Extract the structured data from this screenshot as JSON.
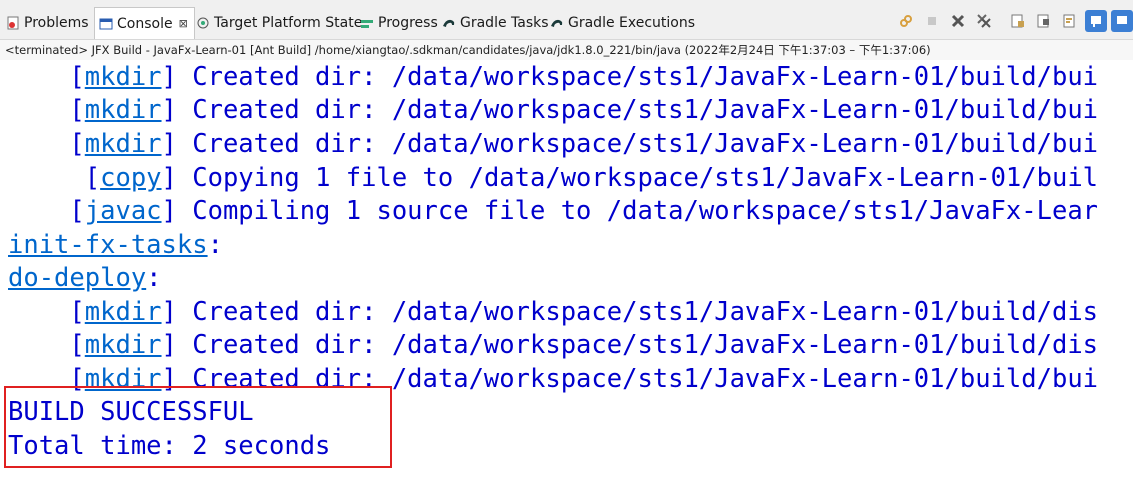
{
  "tabs": [
    {
      "label": "Problems",
      "icon": "problems-icon"
    },
    {
      "label": "Console",
      "icon": "console-icon",
      "close": "⊠"
    },
    {
      "label": "Target Platform State",
      "icon": "target-platform-icon"
    },
    {
      "label": "Progress",
      "icon": "progress-icon"
    },
    {
      "label": "Gradle Tasks",
      "icon": "gradle-icon"
    },
    {
      "label": "Gradle Executions",
      "icon": "gradle-icon"
    }
  ],
  "status": "<terminated> JFX Build - JavaFx-Learn-01 [Ant Build] /home/xiangtao/.sdkman/candidates/java/jdk1.8.0_221/bin/java  (2022年2月24日 下午1:37:03 – 下午1:37:06)",
  "console": {
    "lines": [
      {
        "pre": "    [",
        "tag": "mkdir",
        "post": "] Created dir: /data/workspace/sts1/JavaFx-Learn-01/build/bui"
      },
      {
        "pre": "    [",
        "tag": "mkdir",
        "post": "] Created dir: /data/workspace/sts1/JavaFx-Learn-01/build/bui"
      },
      {
        "pre": "    [",
        "tag": "mkdir",
        "post": "] Created dir: /data/workspace/sts1/JavaFx-Learn-01/build/bui"
      },
      {
        "pre": "     [",
        "tag": "copy",
        "post": "] Copying 1 file to /data/workspace/sts1/JavaFx-Learn-01/buil"
      },
      {
        "pre": "    [",
        "tag": "javac",
        "post": "] Compiling 1 source file to /data/workspace/sts1/JavaFx-Lear"
      },
      {
        "target": "init-fx-tasks",
        "post": ":"
      },
      {
        "target": "do-deploy",
        "post": ":"
      },
      {
        "pre": "    [",
        "tag": "mkdir",
        "post": "] Created dir: /data/workspace/sts1/JavaFx-Learn-01/build/dis"
      },
      {
        "pre": "    [",
        "tag": "mkdir",
        "post": "] Created dir: /data/workspace/sts1/JavaFx-Learn-01/build/dis"
      },
      {
        "pre": "    [",
        "tag": "mkdir",
        "post": "] Created dir: /data/workspace/sts1/JavaFx-Learn-01/build/bui"
      },
      {
        "text": "BUILD SUCCESSFUL"
      },
      {
        "text": "Total time: 2 seconds"
      }
    ]
  },
  "colors": {
    "console_text": "#0000cc",
    "link": "#0066cc",
    "highlight": "#e02020"
  }
}
